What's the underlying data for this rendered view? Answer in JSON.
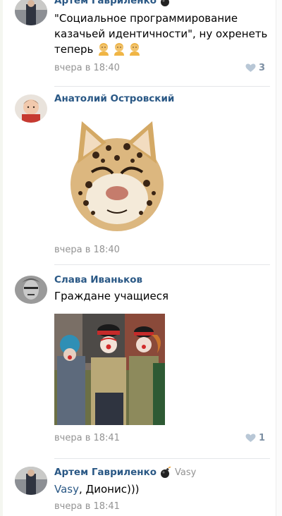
{
  "comments": [
    {
      "author": "Артем Гавриленко",
      "text": "\"Социальное программирование казачьей идентичности\", ну охренеть теперь",
      "emojis": [
        "person-blond-icon",
        "person-blond-icon",
        "person-blond-icon"
      ],
      "date": "вчера в 18:40",
      "likes": "3"
    },
    {
      "author": "Анатолий Островский",
      "sticker": "leopard-sticker",
      "date": "вчера в 18:40"
    },
    {
      "author": "Слава Иваньков",
      "text": "Граждане учащиеся",
      "photo": "cossack-clowns-photo",
      "date": "вчера в 18:41",
      "likes": "1"
    },
    {
      "author": "Артем Гавриленко",
      "reply_to": "Vasy",
      "mention": "Vasy",
      "text": ", Дионис)))",
      "date": "вчера в 18:41"
    }
  ],
  "colors": {
    "link": "#2a5885",
    "meta": "#939393",
    "like": "#7d8fa3",
    "divider": "#e4e6e9"
  }
}
